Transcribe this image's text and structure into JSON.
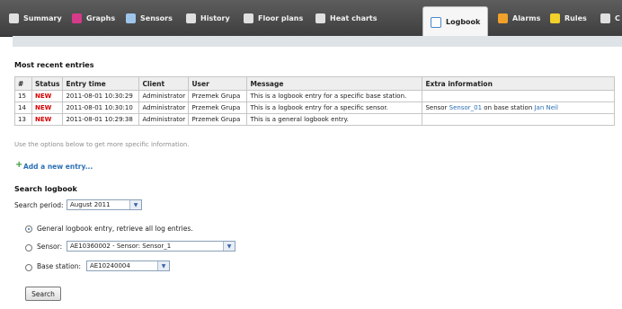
{
  "nav": {
    "tabs": [
      {
        "label": "Summary",
        "icon": "wrench-icon",
        "color": "#e0e0e0"
      },
      {
        "label": "Graphs",
        "icon": "graph-icon",
        "color": "#d63a8a"
      },
      {
        "label": "Sensors",
        "icon": "sensor-icon",
        "color": "#9fc6ea"
      },
      {
        "label": "History",
        "icon": "history-icon",
        "color": "#e0e0e0"
      },
      {
        "label": "Floor plans",
        "icon": "floorplan-icon",
        "color": "#e0e0e0"
      },
      {
        "label": "Heat charts",
        "icon": "heatchart-icon",
        "color": "#e0e0e0"
      },
      {
        "label": "Logbook",
        "icon": "logbook-icon",
        "active": true
      },
      {
        "label": "Alarms",
        "icon": "alarm-icon",
        "color": "#f2a12a"
      },
      {
        "label": "Rules",
        "icon": "rules-icon",
        "color": "#f2d12a"
      },
      {
        "label": "C",
        "icon": "config-icon",
        "color": "#e0e0e0"
      }
    ]
  },
  "recent": {
    "title": "Most recent entries",
    "columns": [
      "#",
      "Status",
      "Entry time",
      "Client",
      "User",
      "Message",
      "Extra information"
    ],
    "rows": [
      {
        "num": "15",
        "status": "NEW",
        "time": "2011-08-01 10:30:29",
        "client": "Administrator",
        "user": "Przemek Grupa",
        "message": "This is a logbook entry for a specific base station.",
        "extra": ""
      },
      {
        "num": "14",
        "status": "NEW",
        "time": "2011-08-01 10:30:10",
        "client": "Administrator",
        "user": "Przemek Grupa",
        "message": "This is a logbook entry for a specific sensor.",
        "extra_pre": "Sensor ",
        "extra_link1": "Sensor_01",
        "extra_mid": " on base station ",
        "extra_link2": "Jan Neil"
      },
      {
        "num": "13",
        "status": "NEW",
        "time": "2011-08-01 10:29:38",
        "client": "Administrator",
        "user": "Przemek Grupa",
        "message": "This is a general logbook entry.",
        "extra": ""
      }
    ]
  },
  "hint": "Use the options below to get more specific information.",
  "add_entry": "Add a new entry...",
  "search": {
    "title": "Search logbook",
    "period_label": "Search period:",
    "period_value": "August 2011",
    "opt_general": "General logbook entry, retrieve all log entries.",
    "opt_sensor_label": "Sensor:",
    "sensor_value": "AE10360002 - Sensor: Sensor_1",
    "opt_base_label": "Base station:",
    "base_value": "AE10240004",
    "button": "Search"
  }
}
